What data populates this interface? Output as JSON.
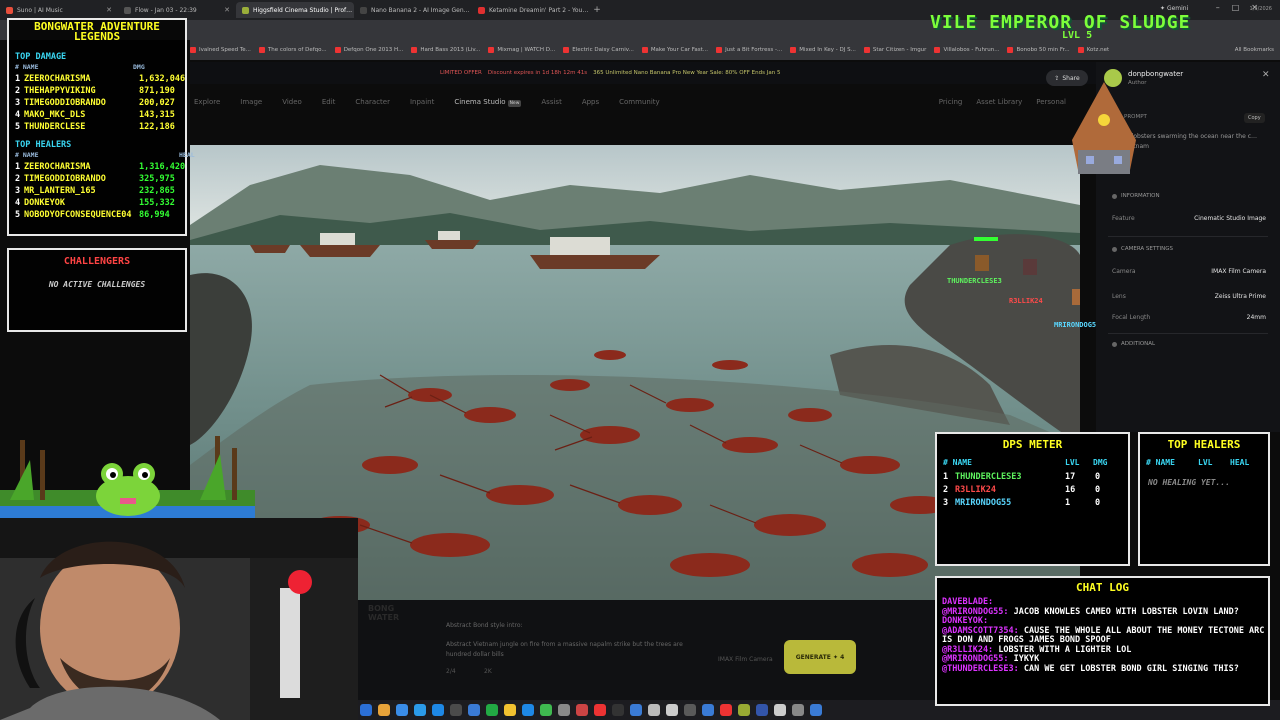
{
  "browser": {
    "tabs": [
      {
        "label": "Suno | AI Music",
        "color": "#e84f3c"
      },
      {
        "label": "Flow - Jan 03 - 22:39",
        "color": "#555555"
      },
      {
        "label": "Higgsfield Cinema Studio | Prof…",
        "color": "#9aae3a",
        "active": true
      },
      {
        "label": "Nano Banana 2 - AI Image Gen…",
        "color": "#444444"
      },
      {
        "label": "Ketamine Dreamin' Part 2 - You…",
        "color": "#e03030"
      }
    ],
    "gemini_label": "Gemini",
    "bookmarks": [
      "Ivalned Speed Te...",
      "The colors of Defqo...",
      "Defqon One 2013 H...",
      "Hard Bass 2013 (Liv...",
      "Mixmag | WATCH D...",
      "Electric Daisy Carniv...",
      "Make Your Car Fast...",
      "Just a Bit Fortress -...",
      "Mixed In Key - DJ S...",
      "Star Citizen - Imgur",
      "Villalobos - Fuhrun...",
      "Bonobo 50 min Fr...",
      "Kotz.net"
    ],
    "all_bookmarks": "All Bookmarks"
  },
  "site": {
    "banner": {
      "tag": "LIMITED OFFER",
      "discount": "Discount expires in 1d 18h 12m 41s",
      "text": "365 Unlimited Nano Banana Pro New Year Sale: 80% OFF Ends Jan 5"
    },
    "nav": [
      {
        "label": "Explore"
      },
      {
        "label": "Image"
      },
      {
        "label": "Video"
      },
      {
        "label": "Edit"
      },
      {
        "label": "Character"
      },
      {
        "label": "Inpaint"
      },
      {
        "label": "Cinema Studio",
        "active": true,
        "badge": "New"
      },
      {
        "label": "Assist"
      },
      {
        "label": "Apps"
      },
      {
        "label": "Community"
      }
    ],
    "nav_right": [
      "Pricing",
      "Asset Library",
      "Personal"
    ],
    "share_label": "Share",
    "author": {
      "name": "donpbongwater",
      "role": "Author"
    },
    "prompt_label": "PROMPT",
    "copy_label": "Copy",
    "prompt_text": "of lobsters swarming the ocean near the c… Vietnam",
    "information_label": "INFORMATION",
    "feature": {
      "k": "Feature",
      "v": "Cinematic Studio Image"
    },
    "camera_settings_label": "CAMERA SETTINGS",
    "camera": {
      "k": "Camera",
      "v": "IMAX Film Camera"
    },
    "lens": {
      "k": "Lens",
      "v": "Zeiss Ultra Prime"
    },
    "focal": {
      "k": "Focal Length",
      "v": "24mm"
    },
    "additional_label": "ADDITIONAL",
    "gen": {
      "line1": "Abstract Bond style intro:",
      "line2": "Abstract Vietnam jungle on fire from a massive napalm strike but the trees are hundred dollar bills",
      "meta": "2/4",
      "meta2": "2K",
      "camera": "IMAX Film Camera",
      "generate": "GENERATE ✦ 4"
    },
    "clock": "1/3/2026"
  },
  "overlay": {
    "legends_title": "BONGWATER ADVENTURE LEGENDS",
    "top_damage_label": "TOP DAMAGE",
    "col_name": "# NAME",
    "col_dmg": "DMG",
    "col_heal": "HEAL",
    "damage": [
      {
        "n": "1",
        "name": "ZEEROCHARISMA",
        "v": "1,632,046"
      },
      {
        "n": "2",
        "name": "THEHAPPYVIKING",
        "v": "871,190"
      },
      {
        "n": "3",
        "name": "TIMEGODDIOBRANDO",
        "v": "200,027"
      },
      {
        "n": "4",
        "name": "MAKO_MKC_DLS",
        "v": "143,315"
      },
      {
        "n": "5",
        "name": "THUNDERCLESE",
        "v": "122,186"
      }
    ],
    "top_healers_label": "TOP HEALERS",
    "healers": [
      {
        "n": "1",
        "name": "ZEEROCHARISMA",
        "v": "1,316,420"
      },
      {
        "n": "2",
        "name": "TIMEGODDIOBRANDO",
        "v": "325,975"
      },
      {
        "n": "3",
        "name": "MR_LANTERN_165",
        "v": "232,865"
      },
      {
        "n": "4",
        "name": "DONKEYOK",
        "v": "155,332"
      },
      {
        "n": "5",
        "name": "NOBODYOFCONSEQUENCE04",
        "v": "86,994"
      }
    ],
    "challengers_title": "CHALLENGERS",
    "challengers_empty": "NO ACTIVE CHALLENGES",
    "boss_name": "VILE EMPEROR OF SLUDGE",
    "boss_lvl": "LVL 5",
    "dps_title": "DPS METER",
    "dps_cols": {
      "name": "# NAME",
      "lvl": "LVL",
      "dmg": "DMG"
    },
    "dps": [
      {
        "n": "1",
        "name": "THUNDERCLESE3",
        "lvl": "17",
        "dmg": "0",
        "color": "#5ef35e"
      },
      {
        "n": "2",
        "name": "R3LLIK24",
        "lvl": "16",
        "dmg": "0",
        "color": "#ff4a4a"
      },
      {
        "n": "3",
        "name": "MRIRONDOG55",
        "lvl": "1",
        "dmg": "0",
        "color": "#5ad7ff"
      }
    ],
    "heal_title": "TOP HEALERS",
    "heal_cols": {
      "name": "# NAME",
      "lvl": "LVL",
      "heal": "HEAL"
    },
    "heal_empty": "NO HEALING YET...",
    "chat_title": "CHAT LOG",
    "chat": [
      {
        "user": "DAVEBLADE:",
        "msg": ""
      },
      {
        "user": "@MRIRONDOG55:",
        "msg": "JACOB KNOWLES CAMEO WITH LOBSTER LOVIN LAND?"
      },
      {
        "user": "DONKEYOK:",
        "msg": ""
      },
      {
        "user": "@ADAMSCOTT7354:",
        "msg": "CAUSE THE WHOLE ALL ABOUT THE MONEY TECTONE ARC IS DON AND FROGS JAMES BOND SPOOF"
      },
      {
        "user": "@R3LLIK24:",
        "msg": "LOBSTER WITH A LIGHTER LOL"
      },
      {
        "user": "@MRIRONDOG55:",
        "msg": "IYKYK"
      },
      {
        "user": "@THUNDERCLESE3:",
        "msg": "CAN WE GET LOBSTER BOND GIRL SINGING THIS?"
      }
    ],
    "game_players": [
      {
        "name": "THUNDERCLESE3",
        "color": "#5ef35e"
      },
      {
        "name": "R3LLIK24",
        "color": "#ff4a4a"
      },
      {
        "name": "MRIRONDOG55",
        "color": "#5ad7ff"
      }
    ]
  }
}
